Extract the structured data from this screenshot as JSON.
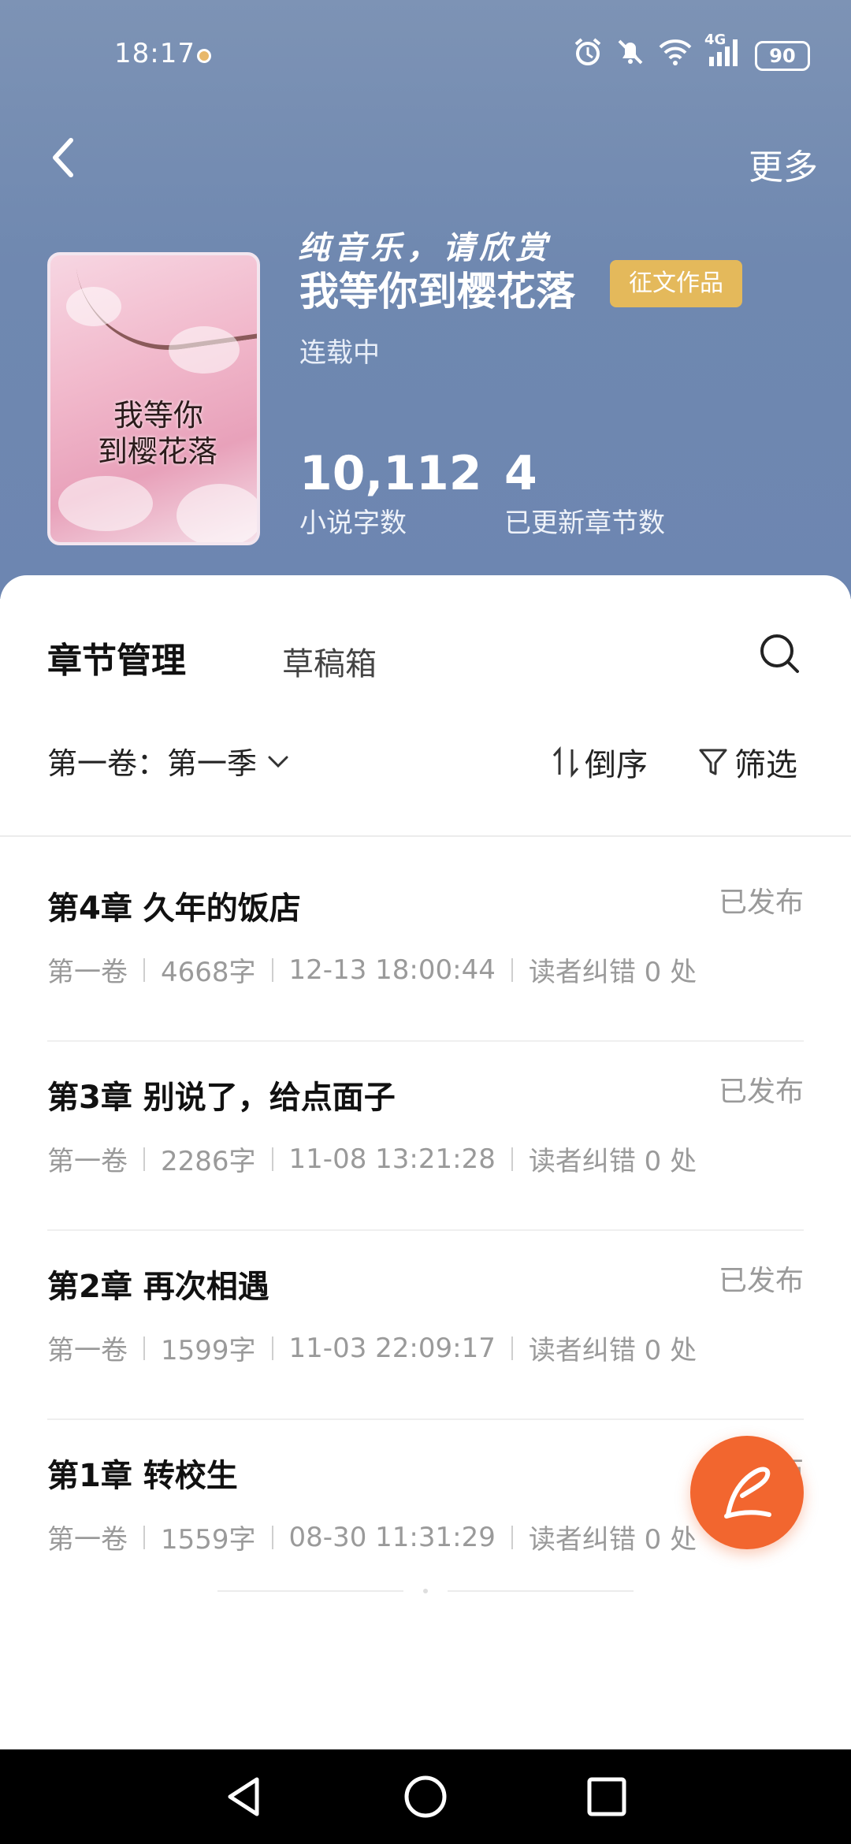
{
  "status_bar": {
    "time": "18:17",
    "network": "4G",
    "battery": "90",
    "icons": [
      "alarm-icon",
      "mute-icon",
      "wifi-icon",
      "signal-icon",
      "battery-icon"
    ]
  },
  "header": {
    "more_label": "更多"
  },
  "book": {
    "script_subtitle": "纯音乐，请欣赏",
    "title": "我等你到樱花落",
    "tag": "征文作品",
    "status": "连载中",
    "cover_title_line1": "我等你",
    "cover_title_line2": "到樱花落"
  },
  "stats": [
    {
      "value": "10,112",
      "label": "小说字数"
    },
    {
      "value": "4",
      "label": "已更新章节数"
    }
  ],
  "tabs": {
    "main": "章节管理",
    "draft": "草稿箱"
  },
  "filters": {
    "volume": "第一卷：第一季",
    "sort": "倒序",
    "filter": "筛选"
  },
  "chapters": [
    {
      "title": "第4章 久年的饭店",
      "state": "已发布",
      "volume": "第一卷",
      "words": "4668字",
      "time": "12-13 18:00:44",
      "errata": "读者纠错 0 处"
    },
    {
      "title": "第3章 别说了，给点面子",
      "state": "已发布",
      "volume": "第一卷",
      "words": "2286字",
      "time": "11-08 13:21:28",
      "errata": "读者纠错 0 处"
    },
    {
      "title": "第2章 再次相遇",
      "state": "已发布",
      "volume": "第一卷",
      "words": "1599字",
      "time": "11-03 22:09:17",
      "errata": "读者纠错 0 处"
    },
    {
      "title": "第1章 转校生",
      "state": "已发布",
      "volume": "第一卷",
      "words": "1559字",
      "time": "08-30 11:31:29",
      "errata": "读者纠错 0 处"
    }
  ],
  "colors": {
    "hero": "#7089b1",
    "tag": "#e4b95b",
    "fab": "#f2662f"
  }
}
